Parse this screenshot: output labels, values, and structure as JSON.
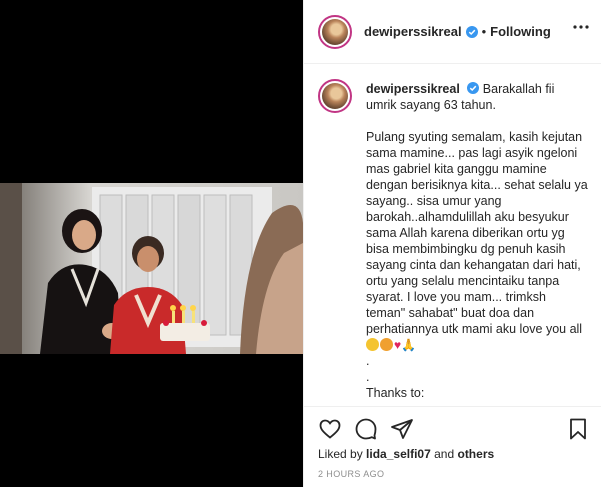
{
  "post": {
    "username": "dewiperssikreal",
    "follow_status": "Following",
    "separator": "•"
  },
  "caption": {
    "username": "dewiperssikreal",
    "line1": "Barakallah fii umrik sayang 63 tahun.",
    "body": "Pulang syuting semalam, kasih kejutan sama mamine... pas lagi asyik ngeloni mas gabriel kita ganggu mamine dengan berisiknya kita... sehat selalu ya sayang.. sisa umur yang barokah..alhamdulillah aku besyukur sama Allah karena diberikan ortu yg bisa membimbingku dg penuh kasih sayang cinta dan kehangatan dari hati, ortu yang selalu mencintaiku tanpa syarat. I love you mam... trimksh teman\" sahabat\" buat doa dan perhatiannya utk mami aku love you all",
    "dot1": ".",
    "dot2": ".",
    "thanks": "Thanks to:"
  },
  "likes": {
    "prefix": "Liked by",
    "user": "lida_selfi07",
    "joiner": "and",
    "others": "others"
  },
  "timestamp": "2 HOURS AGO",
  "icons": [
    "verified-badge-icon",
    "more-options-icon",
    "heart-icon",
    "comment-icon",
    "share-icon",
    "bookmark-icon"
  ],
  "colors": {
    "verified": "#3897f0",
    "border": "#efefef",
    "muted": "#8e8e8e"
  }
}
